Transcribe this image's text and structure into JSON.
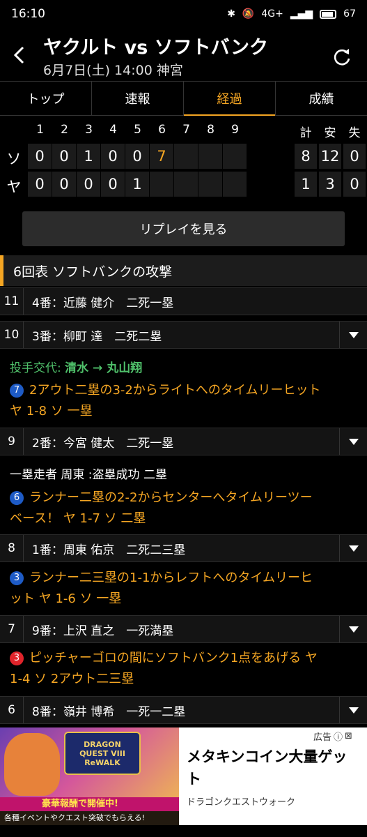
{
  "status": {
    "time": "16:10",
    "network": "4G+",
    "battery": "67"
  },
  "header": {
    "title": "ヤクルト vs ソフトバンク",
    "subtitle": "6月7日(土) 14:00 神宮"
  },
  "tabs": [
    {
      "label": "トップ"
    },
    {
      "label": "速報"
    },
    {
      "label": "経過",
      "active": true
    },
    {
      "label": "成績"
    }
  ],
  "scoreboard": {
    "innings": [
      "1",
      "2",
      "3",
      "4",
      "5",
      "6",
      "7",
      "8",
      "9"
    ],
    "total_heads": [
      "計",
      "安",
      "失"
    ],
    "teams": [
      {
        "abbr": "ソ",
        "scores": [
          "0",
          "0",
          "1",
          "0",
          "0",
          "7",
          "",
          "",
          ""
        ],
        "totals": [
          "8",
          "12",
          "0"
        ]
      },
      {
        "abbr": "ヤ",
        "scores": [
          "0",
          "0",
          "0",
          "0",
          "1",
          "",
          "",
          "",
          ""
        ],
        "totals": [
          "1",
          "3",
          "0"
        ]
      }
    ]
  },
  "replay_label": "リプレイを見る",
  "section_title": "6回表 ソフトバンクの攻撃",
  "plays": [
    {
      "num": "11",
      "text": "4番：近藤 健介　二死一塁"
    },
    {
      "num": "10",
      "text": "3番：柳町 達　二死二塁"
    },
    {
      "num": "9",
      "text": "2番：今宮 健太　二死一塁"
    },
    {
      "num": "8",
      "text": "1番：周東 佑京　二死二三塁"
    },
    {
      "num": "7",
      "text": "9番：上沢 直之　一死満塁"
    },
    {
      "num": "6",
      "text": "8番：嶺井 博希　一死一二塁"
    }
  ],
  "events": {
    "pitch_change_prefix": "投手交代: ",
    "pitch_change_names": "清水 → 丸山翔",
    "steal": "一塁走者 周東 :盗塁成功 二塁",
    "score_plays": [
      {
        "badge": "7",
        "line1": "2アウト二塁の3-2からライトへのタイムリーヒット",
        "line2": "ヤ 1-8 ソ 一塁"
      },
      {
        "badge": "6",
        "line1": "ランナー二塁の2-2からセンターへタイムリーツー",
        "line2": "ベース！ ヤ 1-7 ソ 二塁"
      },
      {
        "badge": "3",
        "line1": "ランナー二三塁の1-1からレフトへのタイムリーヒ",
        "line2": "ット ヤ 1-6 ソ 一塁"
      },
      {
        "badge": "3",
        "line1": "ピッチャーゴロの間にソフトバンク1点をあげる ヤ",
        "line2": "1-4 ソ 2アウト二三塁"
      }
    ]
  },
  "ad": {
    "label": "広告",
    "title": "メタキンコイン大量ゲット",
    "sponsor": "ドラゴンクエストウォーク",
    "image_text": "DRAGON QUEST VIII ReWALK",
    "banner1": "豪華報酬で開催中!",
    "banner2": "各種イベントやクエスト突破でもらえる!"
  }
}
